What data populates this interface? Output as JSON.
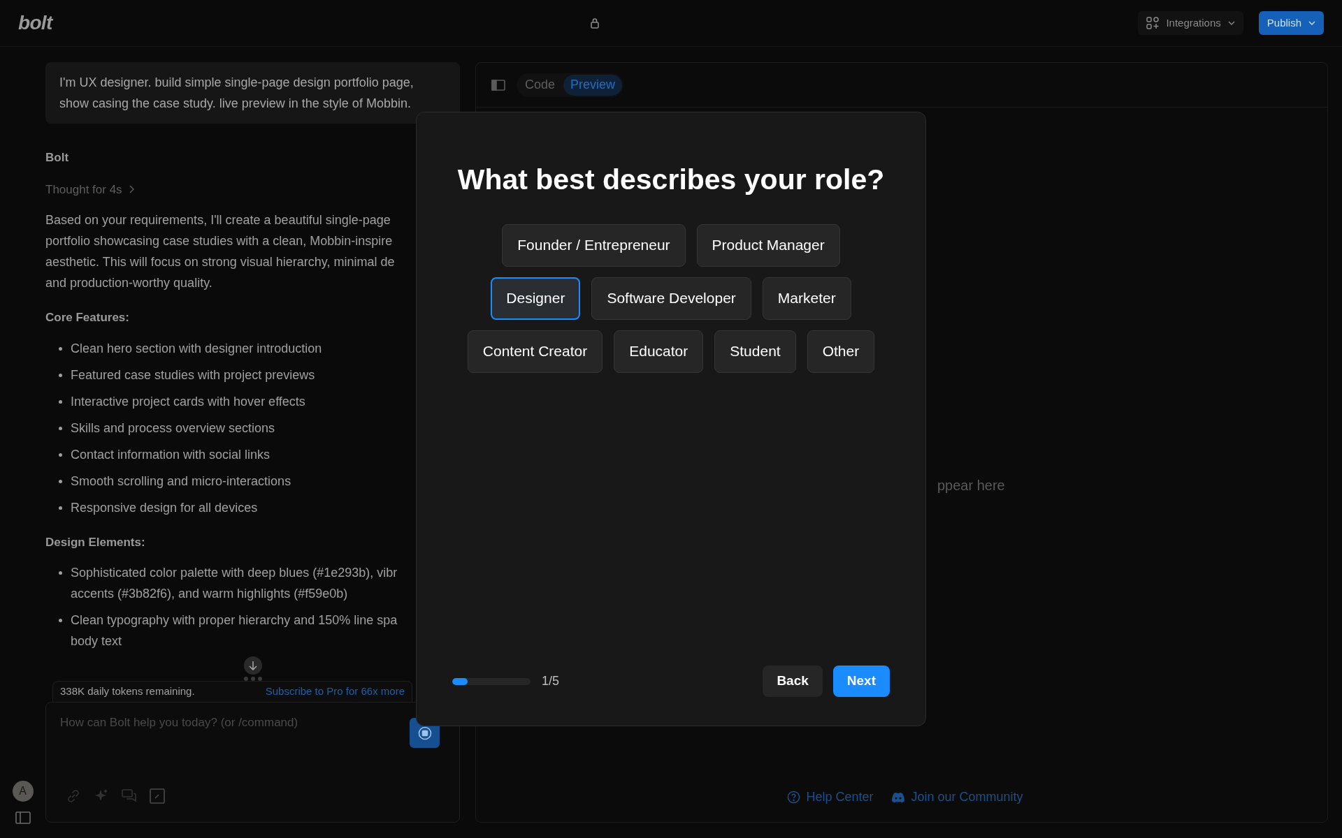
{
  "topbar": {
    "logo": "bolt",
    "integrations": "Integrations",
    "publish": "Publish"
  },
  "chat": {
    "user_message_lines": [
      "I'm UX designer. build simple single-page design portfolio page,",
      "show casing the case study. live preview in the style of Mobbin."
    ],
    "author": "Bolt",
    "thought": "Thought for 4s",
    "paragraph_lines": [
      "Based on your requirements, I'll create a beautiful single-page",
      "portfolio showcasing case studies with a clean, Mobbin-inspire",
      "aesthetic. This will focus on strong visual hierarchy, minimal de",
      "and production-worthy quality."
    ],
    "sections": [
      {
        "heading": "Core Features:",
        "items": [
          {
            "lines": [
              "Clean hero section with designer introduction"
            ]
          },
          {
            "lines": [
              "Featured case studies with project previews"
            ]
          },
          {
            "lines": [
              "Interactive project cards with hover effects"
            ]
          },
          {
            "lines": [
              "Skills and process overview sections"
            ]
          },
          {
            "lines": [
              "Contact information with social links"
            ]
          },
          {
            "lines": [
              "Smooth scrolling and micro-interactions"
            ]
          },
          {
            "lines": [
              "Responsive design for all devices"
            ]
          }
        ]
      },
      {
        "heading": "Design Elements:",
        "items": [
          {
            "lines": [
              "Sophisticated color palette with deep blues (#1e293b), vibr",
              "accents (#3b82f6), and warm highlights (#f59e0b)"
            ]
          },
          {
            "lines": [
              "Clean typography with proper hierarchy and 150% line spa",
              "body text"
            ]
          }
        ]
      }
    ],
    "tokens": {
      "remaining": "338K daily tokens remaining.",
      "subscribe": "Subscribe to Pro for 66x more"
    },
    "input": {
      "placeholder": "How can Bolt help you today? (or /command)"
    },
    "avatar": "A"
  },
  "preview": {
    "tabs": [
      {
        "label": "Code",
        "selected": false
      },
      {
        "label": "Preview",
        "selected": true
      }
    ],
    "empty_text": "ppear here",
    "links": [
      "Help Center",
      "Join our Community"
    ]
  },
  "modal": {
    "title": "What best describes your role?",
    "option_rows": [
      [
        {
          "label": "Founder / Entrepreneur",
          "selected": false
        },
        {
          "label": "Product Manager",
          "selected": false
        }
      ],
      [
        {
          "label": "Designer",
          "selected": true
        },
        {
          "label": "Software Developer",
          "selected": false
        },
        {
          "label": "Marketer",
          "selected": false
        }
      ],
      [
        {
          "label": "Content Creator",
          "selected": false
        },
        {
          "label": "Educator",
          "selected": false
        },
        {
          "label": "Student",
          "selected": false
        },
        {
          "label": "Other",
          "selected": false
        }
      ]
    ],
    "progress": {
      "level": 0.2,
      "step": "1/5"
    },
    "back": "Back",
    "next": "Next"
  }
}
